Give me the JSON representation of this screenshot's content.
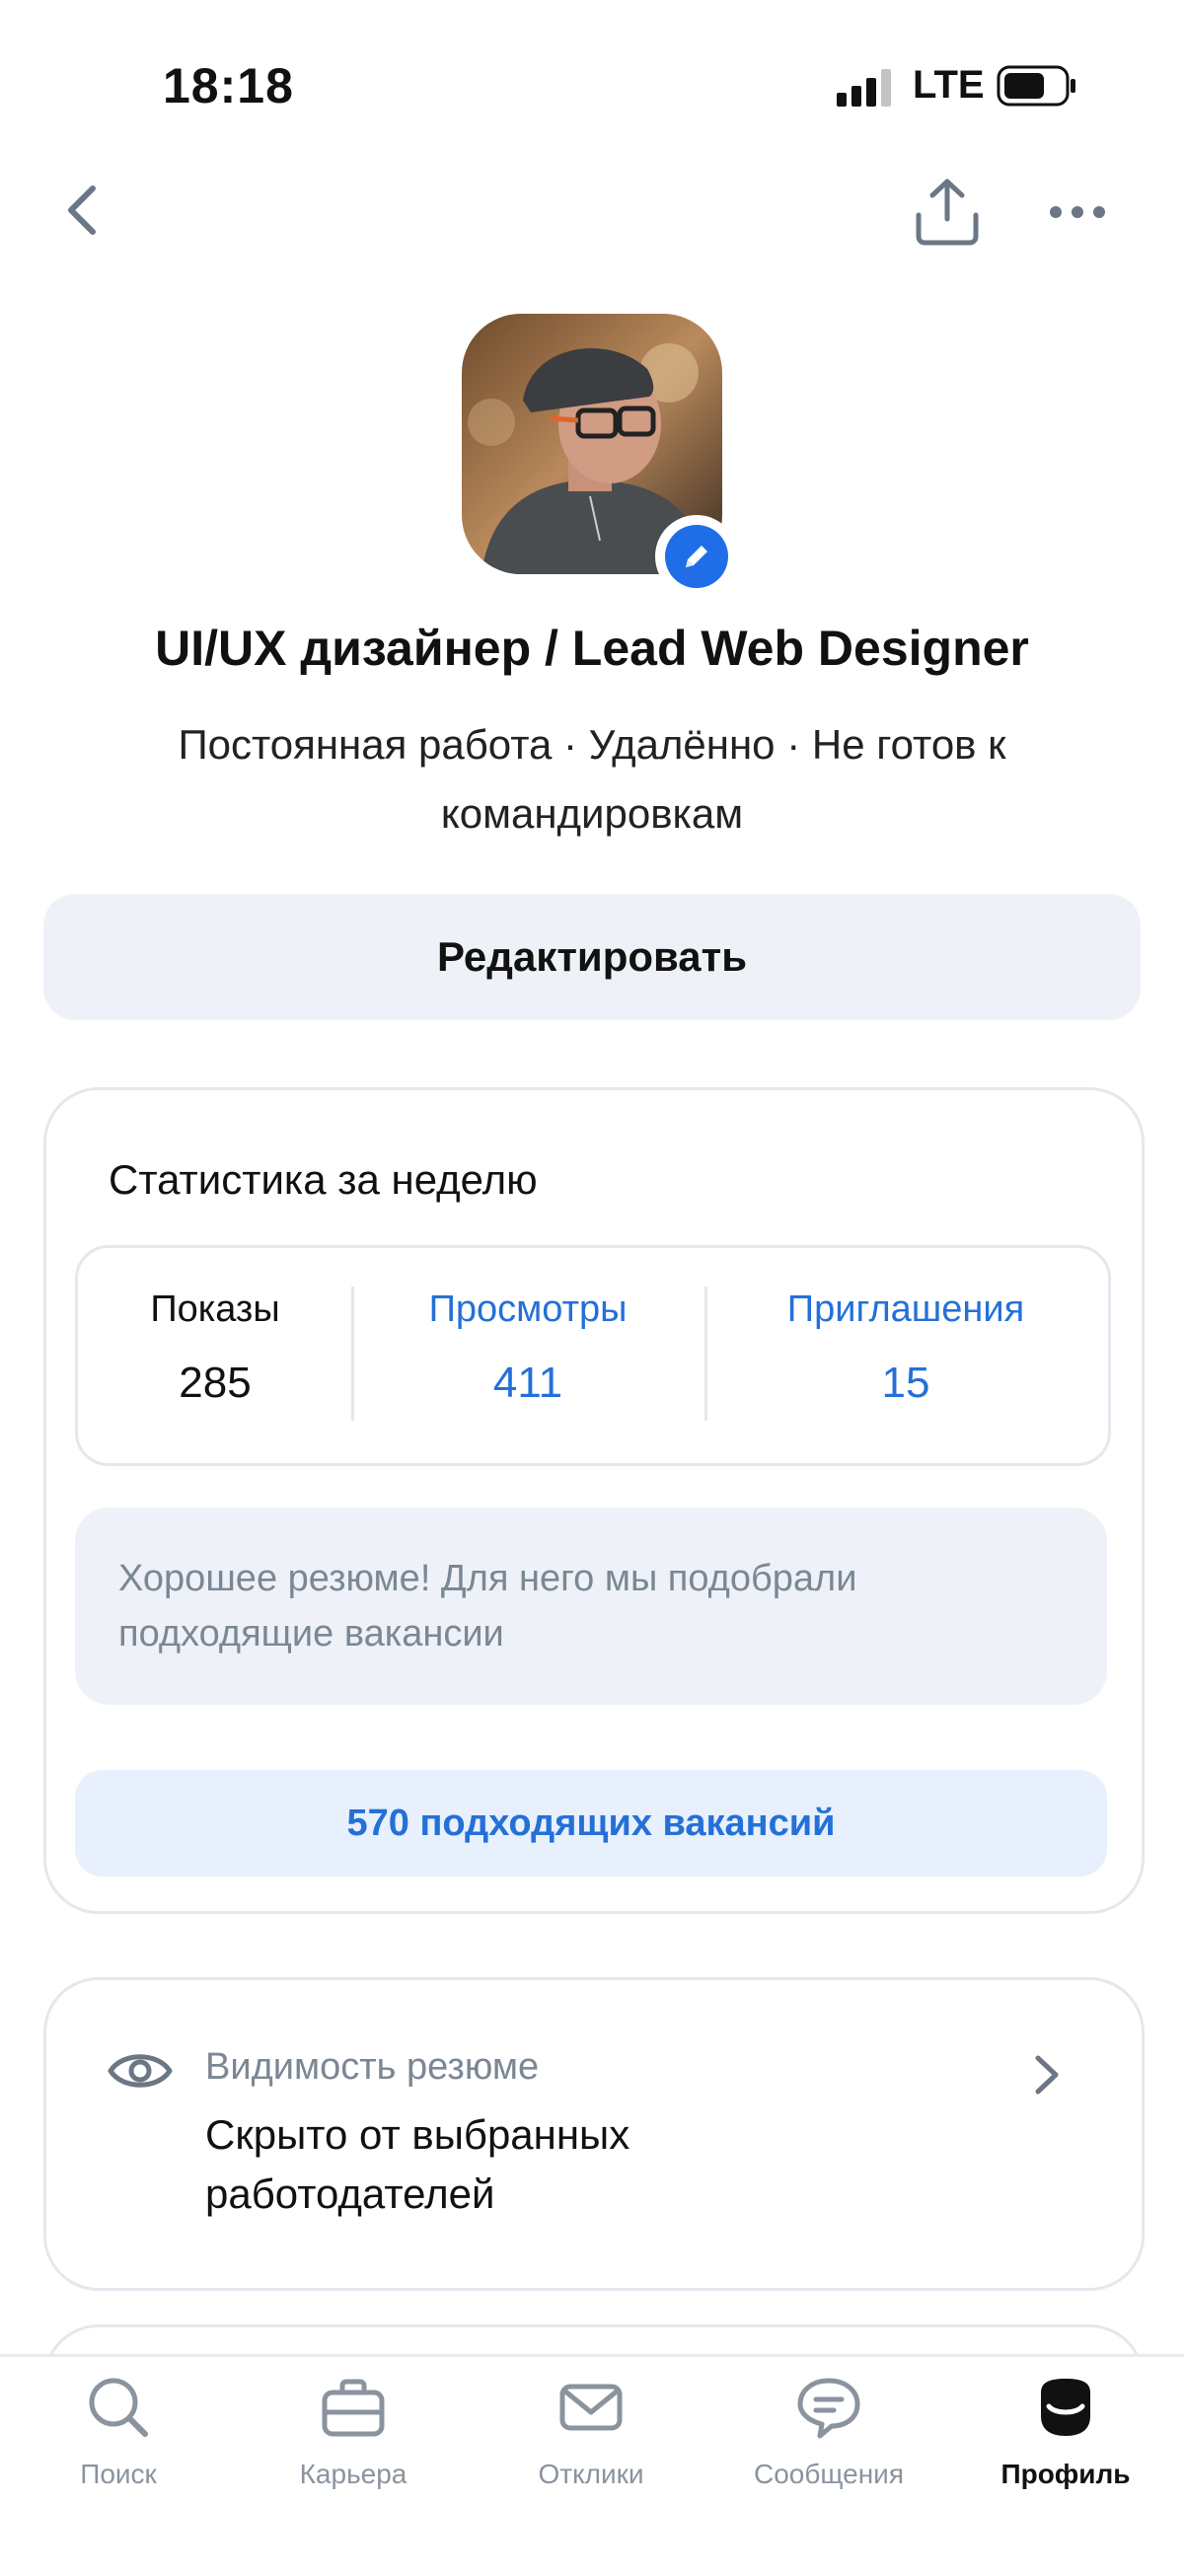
{
  "status_bar": {
    "time": "18:18",
    "network": "LTE",
    "icons": [
      "cellular-signal-icon",
      "battery-icon"
    ]
  },
  "nav": {
    "icons": [
      "back-arrow-icon",
      "share-icon",
      "more-dots-icon"
    ]
  },
  "profile": {
    "title": "UI/UX дизайнер / Lead Web Designer",
    "subtitle": "Постоянная работа · Удалённо · Не готов к командировкам",
    "edit_label": "Редактировать",
    "avatar_badge_icon": "pencil-icon"
  },
  "stats": {
    "title": "Статистика за неделю",
    "items": [
      {
        "label": "Показы",
        "value": "285"
      },
      {
        "label": "Просмотры",
        "value": "411"
      },
      {
        "label": "Приглашения",
        "value": "15"
      }
    ],
    "tip": "Хорошее резюме! Для него мы подобрали подходящие вакансии",
    "vacancies_button": "570 подходящих вакансий"
  },
  "visibility": {
    "label": "Видимость резюме",
    "value": "Скрыто от выбранных работодателей",
    "icon": "eye-icon"
  },
  "tabbar": {
    "items": [
      {
        "label": "Поиск",
        "icon": "search-icon"
      },
      {
        "label": "Карьера",
        "icon": "briefcase-icon"
      },
      {
        "label": "Отклики",
        "icon": "envelope-icon"
      },
      {
        "label": "Сообщения",
        "icon": "chat-icon"
      },
      {
        "label": "Профиль",
        "icon": "profile-icon"
      }
    ],
    "active_index": 4
  },
  "colors": {
    "accent": "#2470d8",
    "badge": "#1f6ee8",
    "surface": "#eef2f8",
    "muted_text": "#7b8794",
    "border": "#e4e8ee"
  }
}
